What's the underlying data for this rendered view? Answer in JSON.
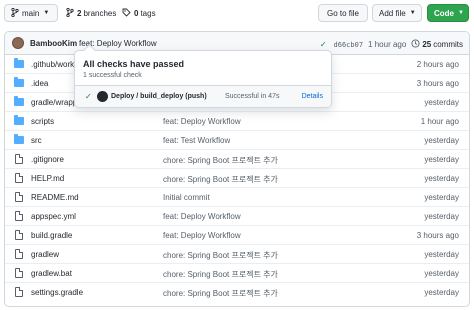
{
  "toolbar": {
    "branch": "main",
    "branches_count": "2",
    "branches_label": "branches",
    "tags_count": "0",
    "tags_label": "tags",
    "go_to_file": "Go to file",
    "add_file": "Add file",
    "code": "Code"
  },
  "commit": {
    "author": "BambooKim",
    "message": "feat: Deploy Workflow",
    "sha": "d66cb07",
    "time": "1 hour ago",
    "count": "25",
    "count_label": "commits"
  },
  "popover": {
    "title": "All checks have passed",
    "subtitle": "1 successful check",
    "job": "Deploy / build_deploy (push)",
    "result": "Successful in 47s",
    "details": "Details"
  },
  "files": [
    {
      "type": "dir",
      "name": ".github/workf",
      "message": "",
      "time": "2 hours ago"
    },
    {
      "type": "dir",
      "name": ".idea",
      "message": "",
      "time": "3 hours ago"
    },
    {
      "type": "dir",
      "name": "gradle/wrapp",
      "message": "",
      "time": "yesterday"
    },
    {
      "type": "dir",
      "name": "scripts",
      "message": "feat: Deploy Workflow",
      "time": "1 hour ago"
    },
    {
      "type": "dir",
      "name": "src",
      "message": "feat: Test Workflow",
      "time": "yesterday"
    },
    {
      "type": "file",
      "name": ".gitignore",
      "message": "chore: Spring Boot 프로젝트 추가",
      "time": "yesterday"
    },
    {
      "type": "file",
      "name": "HELP.md",
      "message": "chore: Spring Boot 프로젝트 추가",
      "time": "yesterday"
    },
    {
      "type": "file",
      "name": "README.md",
      "message": "Initial commit",
      "time": "yesterday"
    },
    {
      "type": "file",
      "name": "appspec.yml",
      "message": "feat: Deploy Workflow",
      "time": "yesterday"
    },
    {
      "type": "file",
      "name": "build.gradle",
      "message": "feat: Deploy Workflow",
      "time": "3 hours ago"
    },
    {
      "type": "file",
      "name": "gradlew",
      "message": "chore: Spring Boot 프로젝트 추가",
      "time": "yesterday"
    },
    {
      "type": "file",
      "name": "gradlew.bat",
      "message": "chore: Spring Boot 프로젝트 추가",
      "time": "yesterday"
    },
    {
      "type": "file",
      "name": "settings.gradle",
      "message": "chore: Spring Boot 프로젝트 추가",
      "time": "yesterday"
    }
  ],
  "colors": {
    "code_button": "#2da44e",
    "folder": "#54aeff",
    "success": "#1a7f37",
    "link": "#0969da"
  }
}
